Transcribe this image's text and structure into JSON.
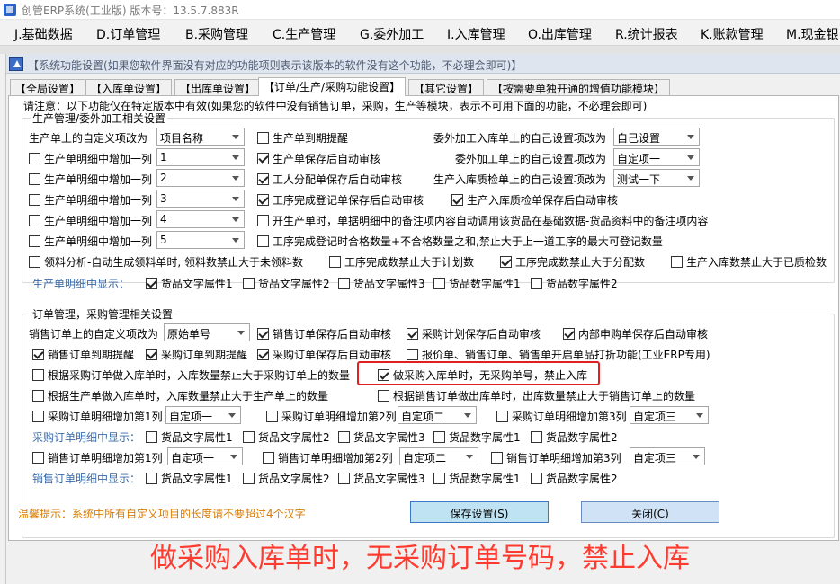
{
  "window": {
    "title": "创管ERP系统(工业版) 版本号：13.5.7.883R"
  },
  "menu": [
    "J.基础数据",
    "D.订单管理",
    "B.采购管理",
    "C.生产管理",
    "G.委外加工",
    "I.入库管理",
    "O.出库管理",
    "R.统计报表",
    "K.账款管理",
    "M.现金银"
  ],
  "panel": {
    "header": "【系统功能设置(如果您软件界面没有对应的功能项则表示该版本的软件没有这个功能，不必理会即可)】"
  },
  "tabs": [
    "【全局设置】",
    "【入库单设置】",
    "【出库单设置】",
    "【订单/生产/采购功能设置】",
    "【其它设置】",
    "【按需要单独开通的增值功能模块】"
  ],
  "notice": "请注意：以下功能仅在特定版本中有效(如果您的软件中没有销售订单，采购，生产等模块，表示不可用下面的功能，不必理会即可)",
  "production": {
    "group_title": "生产管理/委外加工相关设置",
    "custom_label": "生产单上的自定义项改为",
    "custom_value": "项目名称",
    "add_col_label": "生产单明细中增加一列",
    "col_values": [
      "1",
      "2",
      "3",
      "4",
      "5"
    ],
    "col_checked": [
      false,
      false,
      false,
      false,
      false
    ],
    "mid_opts": [
      {
        "label": "生产单到期提醒",
        "checked": false
      },
      {
        "label": "生产单保存后自动审核",
        "checked": true
      },
      {
        "label": "工人分配单保存后自动审核",
        "checked": true
      },
      {
        "label": "工序完成登记单保存后自动审核",
        "checked": true
      },
      {
        "label": "开生产单时，单据明细中的备注项内容自动调用该货品在基础数据-货品资料中的备注项内容",
        "checked": false
      },
      {
        "label": "工序完成登记时合格数量+不合格数量之和,禁止大于上一道工序的最大可登记数量",
        "checked": false
      }
    ],
    "right_settings": [
      {
        "label": "委外加工入库单上的自己设置项改为",
        "value": "自己设置"
      },
      {
        "label": "委外加工单上的自己设置项改为",
        "value": "自定项一"
      },
      {
        "label": "生产入库质检单上的自己设置项改为",
        "value": "测试一下"
      }
    ],
    "qc_auto": {
      "label": "生产入库质检单保存后自动审核",
      "checked": true
    },
    "row7": [
      {
        "label": "领料分析-自动生成领料单时, 领料数禁止大于未领料数",
        "checked": false
      },
      {
        "label": "工序完成数禁止大于计划数",
        "checked": false
      },
      {
        "label": "工序完成数禁止大于分配数",
        "checked": true
      },
      {
        "label": "生产入库数禁止大于已质检数",
        "checked": false
      }
    ],
    "detail_label": "生产单明细中显示：",
    "detail_opts": [
      {
        "label": "货品文字属性1",
        "checked": true
      },
      {
        "label": "货品文字属性2",
        "checked": false
      },
      {
        "label": "货品文字属性3",
        "checked": false
      },
      {
        "label": "货品数字属性1",
        "checked": false
      },
      {
        "label": "货品数字属性2",
        "checked": false
      }
    ]
  },
  "orders": {
    "group_title": "订单管理，采购管理相关设置",
    "custom_label": "销售订单上的自定义项改为",
    "custom_value": "原始单号",
    "row1": [
      {
        "label": "销售订单保存后自动审核",
        "checked": true
      },
      {
        "label": "采购计划保存后自动审核",
        "checked": true
      },
      {
        "label": "内部申购单保存后自动审核",
        "checked": true
      }
    ],
    "row2": [
      {
        "label": "销售订单到期提醒",
        "checked": true
      },
      {
        "label": "采购订单到期提醒",
        "checked": true
      },
      {
        "label": "采购订单保存后自动审核",
        "checked": true
      },
      {
        "label": "报价单、销售订单、销售单开启单品打折功能(工业ERP专用)",
        "checked": false
      }
    ],
    "row3": [
      {
        "label": "根据采购订单做入库单时，入库数量禁止大于采购订单上的数量",
        "checked": false
      },
      {
        "label": "做采购入库单时，无采购单号，禁止入库",
        "checked": true
      }
    ],
    "row4": [
      {
        "label": "根据生产单做入库单时，入库数量禁止大于生产单上的数量",
        "checked": false
      },
      {
        "label": "根据销售订单做出库单时，出库数量禁止大于销售订单上的数量",
        "checked": false
      }
    ],
    "purchase_cols": [
      {
        "label": "采购订单明细增加第1列",
        "checked": false,
        "value": "自定项一"
      },
      {
        "label": "采购订单明细增加第2列",
        "checked": false,
        "value": "自定项二"
      },
      {
        "label": "采购订单明细增加第3列",
        "checked": false,
        "value": "自定项三"
      }
    ],
    "purchase_detail_label": "采购订单明细中显示：",
    "purchase_detail_opts": [
      {
        "label": "货品文字属性1",
        "checked": false
      },
      {
        "label": "货品文字属性2",
        "checked": false
      },
      {
        "label": "货品文字属性3",
        "checked": false
      },
      {
        "label": "货品数字属性1",
        "checked": false
      },
      {
        "label": "货品数字属性2",
        "checked": false
      }
    ],
    "sales_cols": [
      {
        "label": "销售订单明细增加第1列",
        "checked": false,
        "value": "自定项一"
      },
      {
        "label": "销售订单明细增加第2列",
        "checked": false,
        "value": "自定项二"
      },
      {
        "label": "销售订单明细增加第3列",
        "checked": false,
        "value": "自定项三"
      }
    ],
    "sales_detail_label": "销售订单明细中显示：",
    "sales_detail_opts": [
      {
        "label": "货品文字属性1",
        "checked": false
      },
      {
        "label": "货品文字属性2",
        "checked": false
      },
      {
        "label": "货品文字属性3",
        "checked": false
      },
      {
        "label": "货品数字属性1",
        "checked": false
      },
      {
        "label": "货品数字属性2",
        "checked": false
      }
    ]
  },
  "footer": {
    "hint": "温馨提示：系统中所有自定义项目的长度请不要超过4个汉字",
    "save": "保存设置(S)",
    "close": "关闭(C)"
  },
  "caption": "做采购入库单时，无采购订单号码，禁止入库"
}
